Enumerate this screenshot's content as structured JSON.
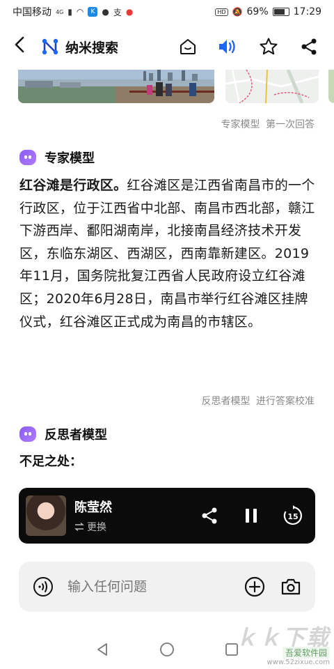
{
  "status_bar": {
    "carrier": "中国移动",
    "network": "4G",
    "battery": "69%",
    "battery_level": 0.69,
    "hd": "HD",
    "time": "17:29"
  },
  "header": {
    "title": "纳米搜索"
  },
  "expert_meta": {
    "model_label": "专家模型",
    "round_label": "第一次回答"
  },
  "expert": {
    "name": "专家模型",
    "answer_bold": "红谷滩是行政区。",
    "answer_rest": "红谷滩区是江西省南昌市的一个行政区，位于江西省中北部、南昌市西北部，赣江下游西岸、鄱阳湖南岸，北接南昌经济技术开发区，东临东湖区、西湖区，西南靠新建区。2019年11月，国务院批复江西省人民政府设立红谷滩区；2020年6月28日，南昌市举行红谷滩区挂牌仪式，红谷滩区正式成为南昌的市辖区。"
  },
  "reflector_meta": {
    "model_label": "反思者模型",
    "action_label": "进行答案校准"
  },
  "reflector": {
    "name": "反思者模型",
    "subheading": "不足之处："
  },
  "player": {
    "voice_name": "陈莹然",
    "switch_label": "更换",
    "replay_seconds": "15"
  },
  "input": {
    "placeholder": "输入任何问题"
  },
  "watermark": {
    "big": "ｋｋ下载",
    "name": "吾爱软件园",
    "url": "www.52zixue.com"
  }
}
